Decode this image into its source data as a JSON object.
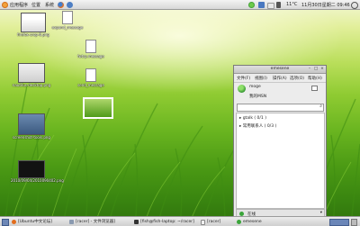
{
  "top_panel": {
    "menu_apps": "应用程序",
    "menu_places": "位置",
    "menu_system": "系统",
    "volume_text": "11°C",
    "clock": "11月30日星期二 09:46"
  },
  "desktop": {
    "icons": [
      {
        "label": "firefox-crop-6.png"
      },
      {
        "label": "expand_message"
      },
      {
        "label": "fwtrp.message"
      },
      {
        "label": "nautilus-desktop.png"
      },
      {
        "label": "send_message"
      },
      {
        "label": "screenshot-tools.png"
      },
      {
        "label": "2010/09/04/2010090402.png"
      }
    ]
  },
  "emesene": {
    "title": "emesene",
    "menu": [
      "文件(F)",
      "视图(I)",
      "操作(A)",
      "选项(O)",
      "帮助(H)"
    ],
    "nickname": "moge",
    "personal_message": "我的MSN",
    "groups": [
      {
        "label": "gtalk ( 0/1 )"
      },
      {
        "label": "常用联系人 ( 0/3 )"
      }
    ],
    "status": "在线",
    "colors": {
      "online": "#3aa53a"
    }
  },
  "taskbar": {
    "tasks": [
      {
        "label": "[Ubuntu中文论坛]"
      },
      {
        "label": "[racer] - 文件浏览器]"
      },
      {
        "label": "[fish@fish-laptop: ~/racer]"
      },
      {
        "label": "[racer]"
      },
      {
        "label": "emesene"
      }
    ]
  }
}
